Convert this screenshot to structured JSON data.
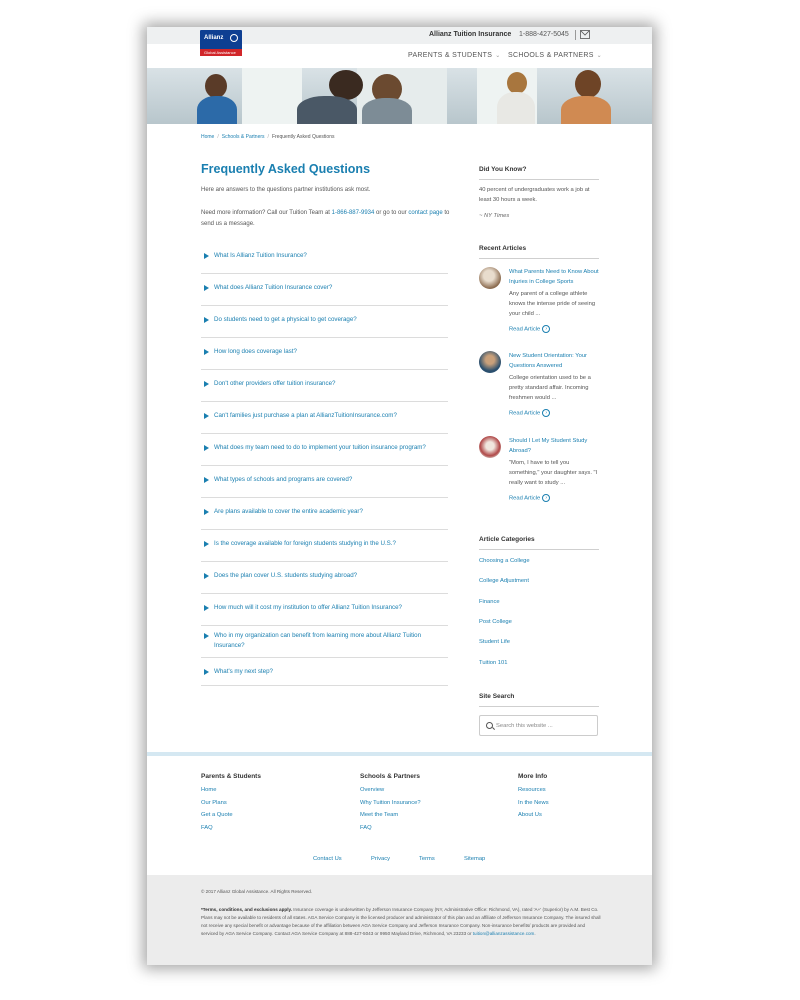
{
  "header": {
    "brand_link": "Allianz Tuition Insurance",
    "phone": "1-888-427-5045",
    "logo_word": "Allianz",
    "logo_sub": "Global Assistance",
    "nav": [
      {
        "label": "PARENTS & STUDENTS"
      },
      {
        "label": "SCHOOLS & PARTNERS"
      }
    ]
  },
  "breadcrumb": {
    "home": "Home",
    "section": "Schools & Partners",
    "current": "Frequently Asked Questions"
  },
  "main": {
    "title": "Frequently Asked Questions",
    "intro1": "Here are answers to the questions partner institutions ask most.",
    "intro2_pre": "Need more information? Call our Tuition Team at ",
    "intro2_phone": "1-866-887-9934",
    "intro2_mid": " or go to our ",
    "intro2_link": "contact page",
    "intro2_post": " to send us a message.",
    "faqs": [
      "What Is Allianz Tuition Insurance?",
      "What does Allianz Tuition Insurance cover?",
      "Do students need to get a physical to get coverage?",
      "How long does coverage last?",
      "Don't other providers offer tuition insurance?",
      "Can't families just purchase a plan at AllianzTuitionInsurance.com?",
      "What does my team need to do to implement your tuition insurance program?",
      "What types of schools and programs are covered?",
      "Are plans available to cover the entire academic year?",
      "Is the coverage available for foreign students studying in the U.S.?",
      "Does the plan cover U.S. students studying abroad?",
      "How much will it cost my institution to offer Allianz Tuition Insurance?",
      "Who in my organization can benefit from learning more about Allianz Tuition Insurance?",
      "What's my next step?"
    ]
  },
  "sidebar": {
    "did_you_know": {
      "heading": "Did You Know?",
      "text": "40 percent of undergraduates work a job at least 30 hours a week.",
      "source": "~ NY Times"
    },
    "recent": {
      "heading": "Recent Articles",
      "read_label": "Read Article",
      "articles": [
        {
          "title": "What Parents Need to Know About Injuries in College Sports",
          "excerpt": "Any parent of a college athlete knows the intense pride of seeing your child ..."
        },
        {
          "title": "New Student Orientation: Your Questions Answered",
          "excerpt": "College orientation used to be a pretty standard affair. Incoming freshmen would ..."
        },
        {
          "title": "Should I Let My Student Study Abroad?",
          "excerpt": "\"Mom, I have to tell you something,\" your daughter says. \"I really want to study ..."
        }
      ]
    },
    "categories": {
      "heading": "Article Categories",
      "items": [
        "Choosing a College",
        "College Adjustment",
        "Finance",
        "Post College",
        "Student Life",
        "Tuition 101"
      ]
    },
    "search": {
      "heading": "Site Search",
      "placeholder": "Search this website ..."
    }
  },
  "footer": {
    "cols": [
      {
        "heading": "Parents & Students",
        "links": [
          "Home",
          "Our Plans",
          "Get a Quote",
          "FAQ"
        ]
      },
      {
        "heading": "Schools & Partners",
        "links": [
          "Overview",
          "Why Tuition Insurance?",
          "Meet the Team",
          "FAQ"
        ]
      },
      {
        "heading": "More Info",
        "links": [
          "Resources",
          "In the News",
          "About Us"
        ]
      }
    ],
    "bottom_links": [
      "Contact Us",
      "Privacy",
      "Terms",
      "Sitemap"
    ],
    "copyright": "© 2017 Allianz Global Assistance. All Rights Reserved.",
    "terms_bold": "*Terms, conditions, and exclusions apply.",
    "terms_text": " Insurance coverage is underwritten by Jefferson Insurance Company (NY, Administrative Office: Richmond, VA), rated 'A+' (Superior) by A.M. Best Co. Plans may not be available to residents of all states. AGA Service Company is the licensed producer and administrator of this plan and an affiliate of Jefferson Insurance Company. The insured shall not receive any special benefit or advantage because of the affiliation between AGA Service Company and Jefferson Insurance Company. Non-insurance benefits/ products are provided and serviced by AGA Service Company. Contact AGA Service Company at 888-427-5043 or 9950 Mayland Drive, Richmond, VA 23233 or ",
    "terms_email": "tuition@allianzassistance.com",
    "terms_end": "."
  },
  "colors": {
    "accent": "#1a7fb0",
    "brand_blue": "#0e3f92",
    "brand_red": "#d1262a"
  }
}
